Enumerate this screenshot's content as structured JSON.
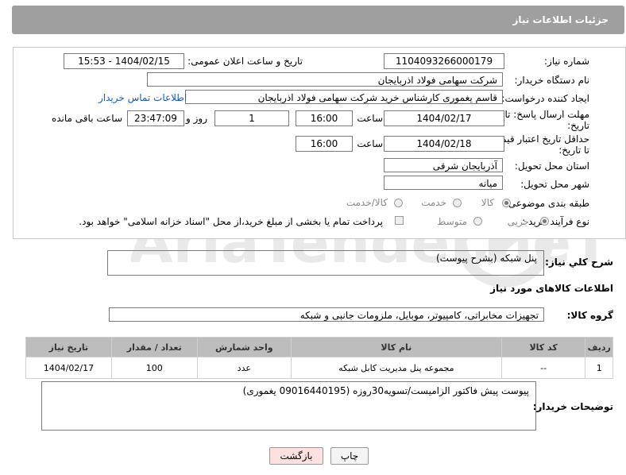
{
  "header": {
    "title": "جزئیات اطلاعات نیاز"
  },
  "fields": {
    "need_number_label": "شماره نیاز:",
    "need_number": "1104093266000179",
    "announce_label": "تاریخ و ساعت اعلان عمومی:",
    "announce_value": "1404/02/15 - 15:53",
    "buyer_org_label": "نام دستگاه خریدار:",
    "buyer_org": "شرکت سهامی فولاد اذربایجان",
    "creator_label": "ایجاد کننده درخواست:",
    "creator": "قاسم یغموری کارشناس خرید شرکت سهامی فولاد اذربایجان",
    "contact_link": "اطلاعات تماس خریدار",
    "deadline_label_1": "مهلت ارسال پاسخ: تا",
    "deadline_label_2": "تاریخ:",
    "deadline_date": "1404/02/17",
    "time_label": "ساعت",
    "deadline_time": "16:00",
    "days_value": "1",
    "days_label": "روز و",
    "remaining_time": "23:47:09",
    "remaining_label": "ساعت باقی مانده",
    "validity_label_1": "حداقل تاریخ اعتبار قیمت:",
    "validity_label_2": "تا تاریخ:",
    "validity_date": "1404/02/18",
    "validity_time": "16:00",
    "province_label": "استان محل تحویل:",
    "province": "آذربایجان شرقی",
    "city_label": "شهر محل تحویل:",
    "city": "میانه",
    "category_label": "طبقه بندی موضوعی:",
    "category_options": [
      "کالا",
      "خدمت",
      "کالا/خدمت"
    ],
    "process_label": "نوع فرآیند خرید :",
    "process_options": [
      "جزیی",
      "متوسط"
    ],
    "payment_note": "پرداخت تمام یا بخشی از مبلغ خرید،از محل \"اسناد خزانه اسلامی\" خواهد بود."
  },
  "description": {
    "label": "شرح كلي نياز:",
    "value": "پنل شبکه (بشرح پیوست)"
  },
  "goods": {
    "section_title": "اطلاعات کالاهای مورد نیاز",
    "group_label": "گروه کالا:",
    "group_value": "تجهیزات مخابراتی، کامپیوتر، موبایل، ملزومات جانبی و شبکه",
    "columns": [
      "ردیف",
      "کد کالا",
      "نام کالا",
      "واحد شمارش",
      "تعداد / مقدار",
      "تاریخ نیاز"
    ],
    "rows": [
      [
        "1",
        "--",
        "مجموعه پنل مدیریت کابل شبکه",
        "عدد",
        "100",
        "1404/02/17"
      ]
    ]
  },
  "buyer_notes": {
    "label": "توضیحات خریدار:",
    "value": "پیوست پیش فاکتور الزامیست/تسویه30روزه (09016440195 یغموری)"
  },
  "buttons": {
    "print": "چاپ",
    "back": "بازگشت"
  },
  "watermark": {
    "text": "AriaTender.neT"
  },
  "colors": {
    "header_bg": "#9f9f9f",
    "link": "#1b57c4",
    "back_button_bg": "#fde0e0"
  }
}
